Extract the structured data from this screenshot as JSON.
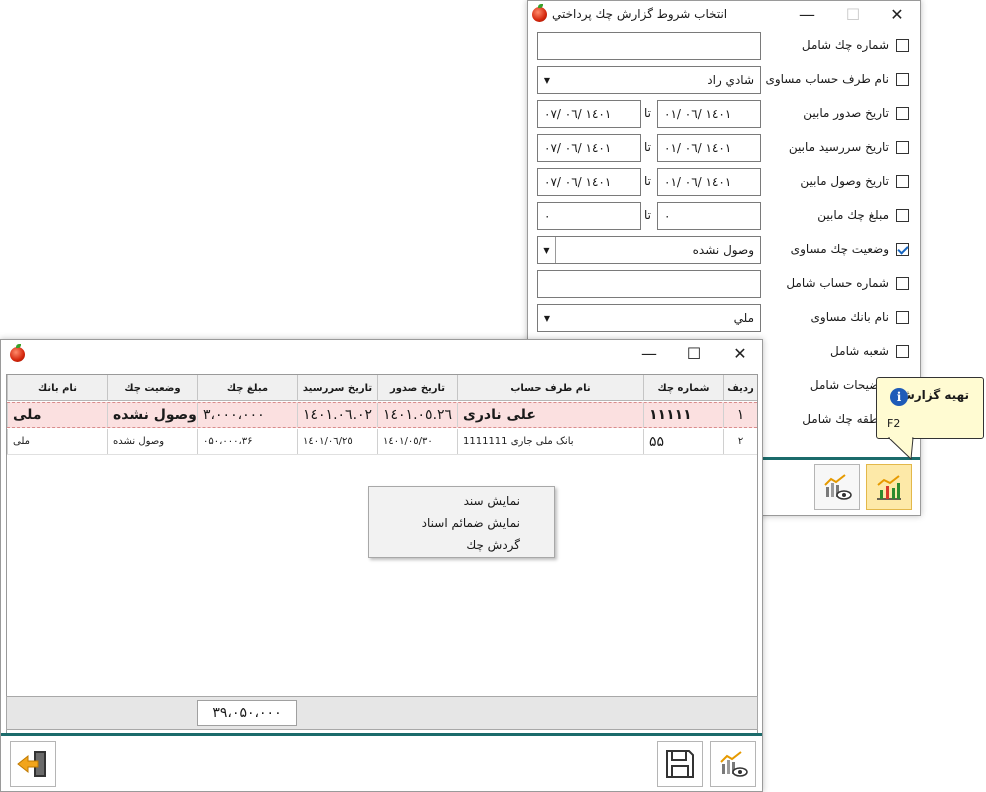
{
  "filter_window": {
    "title": "انتخاب شروط گزارش چك پرداختي",
    "rows": [
      {
        "label": "شماره چك شامل",
        "checked": false,
        "value": ""
      },
      {
        "label": "نام طرف حساب مساوی",
        "checked": false,
        "value": "شادي راد"
      },
      {
        "label": "تاريخ صدور مابين",
        "checked": false,
        "from": "١٤٠١ /٠٦ /٠١",
        "to": "١٤٠١ /٠٦ /٠٧"
      },
      {
        "label": "تاريخ سررسيد مابين",
        "checked": false,
        "from": "١٤٠١ /٠٦ /٠١",
        "to": "١٤٠١ /٠٦ /٠٧"
      },
      {
        "label": "تاريخ وصول مابين",
        "checked": false,
        "from": "١٤٠١ /٠٦ /٠١",
        "to": "١٤٠١ /٠٦ /٠٧"
      },
      {
        "label": "مبلغ چك مابين",
        "checked": false,
        "from": "٠",
        "to": "٠"
      },
      {
        "label": "وضعيت چك مساوی",
        "checked": true,
        "value": "وصول نشده"
      },
      {
        "label": "شماره حساب شامل",
        "checked": false,
        "value": ""
      },
      {
        "label": "نام بانك مساوی",
        "checked": false,
        "value": "ملي"
      },
      {
        "label": "شعبه شامل",
        "checked": false
      },
      {
        "label": "توضيحات شامل",
        "checked": false
      },
      {
        "label": "منطقه چك شامل",
        "checked": false
      }
    ],
    "ta_label": "تا",
    "colors": {
      "accent_bar": "#1b6b6b",
      "highlight_button": "#fde9a8",
      "check": "#1565c0"
    }
  },
  "report_window": {
    "columns": [
      "رديف",
      "شماره چك",
      "نام طرف حساب",
      "تاريخ صدور",
      "تاريخ سررسيد",
      "مبلغ چك",
      "وضعيت چك",
      "نام بانك"
    ],
    "rows": [
      [
        "١",
        "١١١١١",
        "علی نادری",
        "١٤٠١.٠٥.٢٦",
        "١٤٠١.٠٦.٠٢",
        "٣،٠٠٠،٠٠٠",
        "وصول نشده",
        "ملی"
      ],
      [
        "٢",
        "۵۵",
        "بانک ملی جاری 1111111",
        "١٤٠١/٠٥/٣٠",
        "١٤٠١/٠٦/٢٥",
        "٣۶،٠۵٠،٠٠٠",
        "وصول نشده",
        "ملی"
      ]
    ],
    "total": "٣٩،٠۵٠،٠٠٠",
    "context_menu": [
      "نمايش سند",
      "نمايش ضمائم اسناد",
      "گردش چك"
    ]
  },
  "tooltip": {
    "title": "تهيه گزارش",
    "shortcut": "F2"
  }
}
